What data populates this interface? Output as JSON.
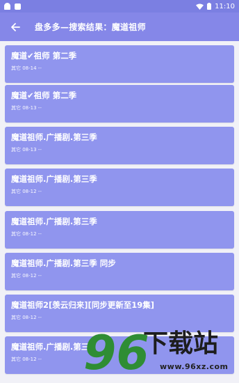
{
  "status": {
    "time": "11:10"
  },
  "header": {
    "title": "盘多多—搜索结果：魔道祖师"
  },
  "results": [
    {
      "title": "魔道✔祖师 第二季",
      "meta": "其它 08-14 --"
    },
    {
      "title": "魔道✔祖师 第二季",
      "meta": "其它 08-13 --"
    },
    {
      "title": "魔道祖师.广播剧.第三季",
      "meta": "其它 08-13 --"
    },
    {
      "title": "魔道祖师.广播剧.第三季",
      "meta": "其它 08-12 --"
    },
    {
      "title": "魔道祖师.广播剧.第三季",
      "meta": "其它 08-12 --"
    },
    {
      "title": "魔道祖师.广播剧.第三季 同步",
      "meta": "其它 08-12 --"
    },
    {
      "title": "魔道祖师2[羡云归来][同步更新至19集]",
      "meta": "其它 08-12 --"
    },
    {
      "title": "魔道祖师.广播剧.第三",
      "meta": "其它 08-12 --"
    }
  ],
  "watermark": {
    "number": "96",
    "text": "下载站",
    "url": "www.96xz.com"
  },
  "colors": {
    "status_bar": "#7b7fe2",
    "app_bar": "#8587e8",
    "card": "#9095ee",
    "background": "#f1f1f7"
  }
}
